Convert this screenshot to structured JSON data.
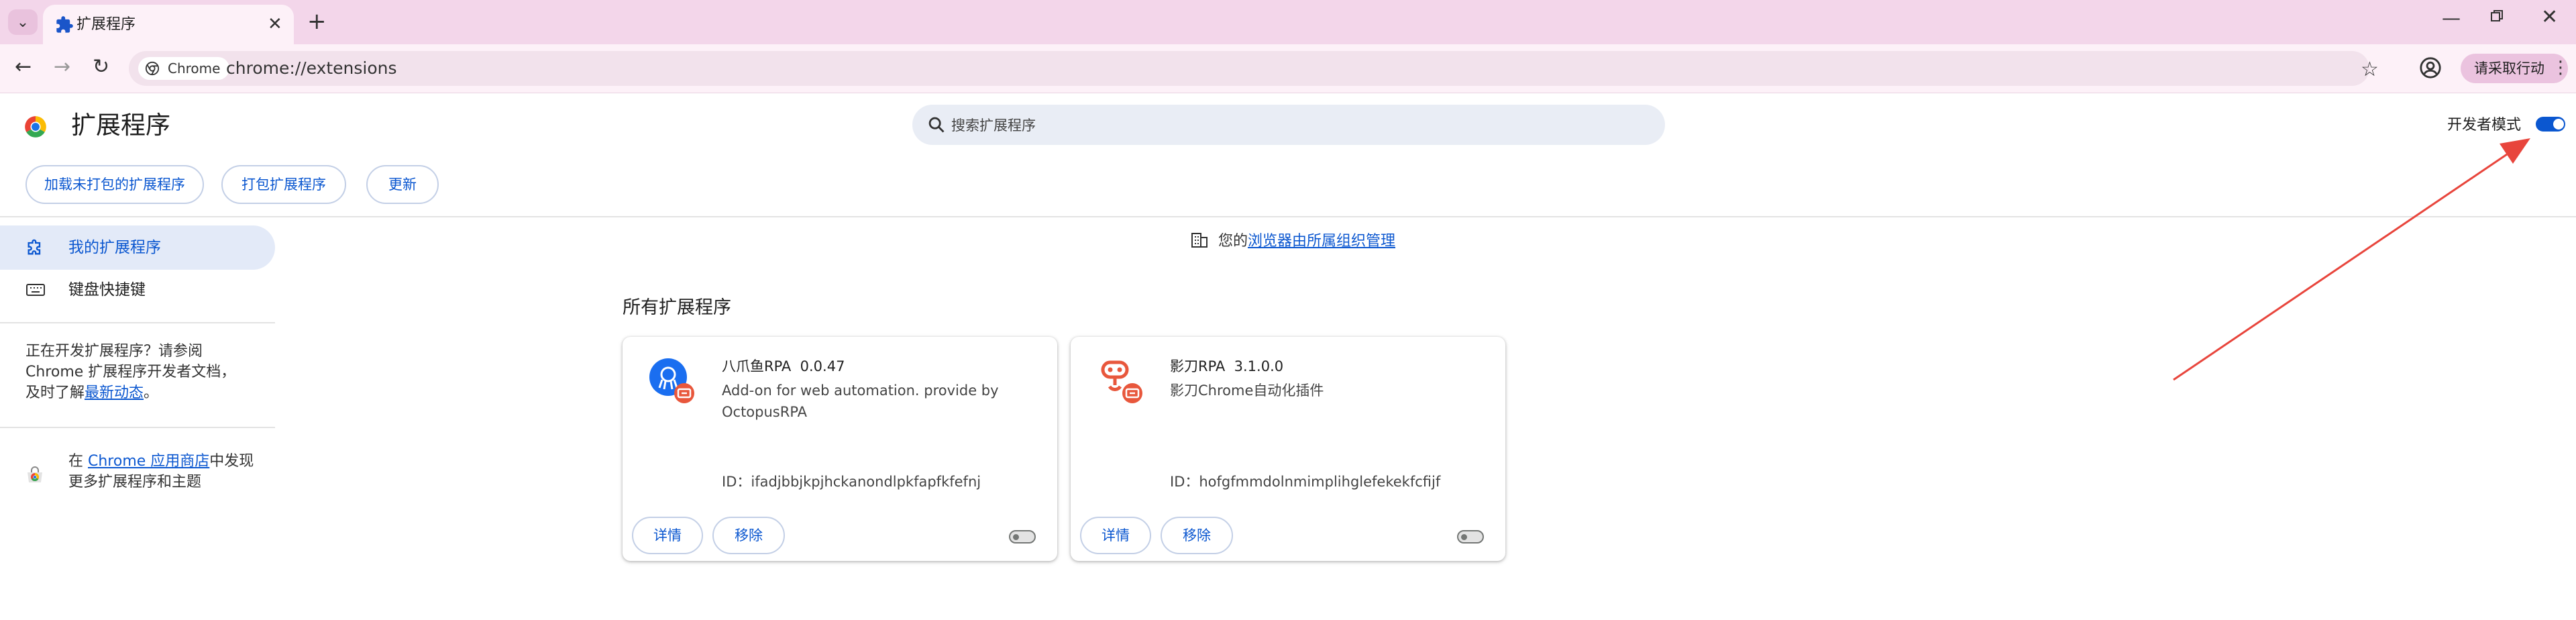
{
  "browser": {
    "tab": {
      "title": "扩展程序",
      "icon": "puzzle-icon"
    },
    "address_chip": "Chrome",
    "url": "chrome://extensions",
    "profile_menu_label": "请采取行动"
  },
  "header": {
    "title": "扩展程序",
    "search_placeholder": "搜索扩展程序",
    "dev_mode_label": "开发者模式",
    "dev_mode_on": true
  },
  "dev_actions": {
    "load_unpacked": "加载未打包的扩展程序",
    "pack": "打包扩展程序",
    "update": "更新"
  },
  "sidebar": {
    "items": [
      {
        "label": "我的扩展程序",
        "icon": "extension-icon",
        "selected": true
      },
      {
        "label": "键盘快捷键",
        "icon": "keyboard-icon",
        "selected": false
      }
    ],
    "dev_note": {
      "text": "正在开发扩展程序？请参阅 Chrome 扩展程序开发者文档，及时了解",
      "link": "最新动态",
      "suffix": "。"
    },
    "store_note": {
      "prefix": "在 ",
      "link": "Chrome 应用商店",
      "suffix": "中发现更多扩展程序和主题"
    }
  },
  "main": {
    "managed": {
      "prefix": "您的",
      "link": "浏览器由所属组织管理"
    },
    "section_title": "所有扩展程序",
    "extensions": [
      {
        "name": "八爪鱼RPA",
        "version": "0.0.47",
        "description": "Add-on for web automation. provide by OctopusRPA",
        "id_label": "ID：",
        "id": "ifadjbbjkpjhckanondlpkfapfkfefnj",
        "details_label": "详情",
        "remove_label": "移除",
        "enabled": false,
        "icon": "octopus-rpa-icon"
      },
      {
        "name": "影刀RPA",
        "version": "3.1.0.0",
        "description": "影刀Chrome自动化插件",
        "id_label": "ID：",
        "id": "hofgfmmdolnmimplihglefekekfcfijf",
        "details_label": "详情",
        "remove_label": "移除",
        "enabled": false,
        "icon": "shadowbot-rpa-icon"
      }
    ]
  },
  "colors": {
    "accent": "#0b57d0",
    "tabstrip": "#f3d6ea",
    "annotation_arrow": "#e8453c"
  }
}
